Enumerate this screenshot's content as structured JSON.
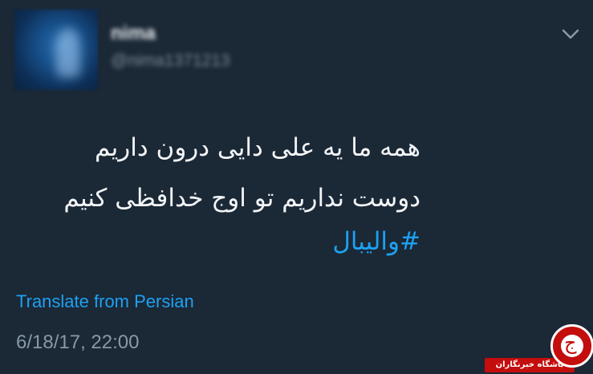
{
  "tweet": {
    "author_name": "nima",
    "author_handle": "@nima1371213",
    "lines": [
      "همه ما یه علی دایی درون داریم",
      "دوست نداریم تو اوج خدافظی کنیم"
    ],
    "hashtag": "#والیبال",
    "translate_label": "Translate from Persian",
    "timestamp": "6/18/17, 22:00"
  },
  "icons": {
    "menu": "chevron-down-icon",
    "watermark_logo": "news-club-logo"
  },
  "watermark": {
    "text": "باشگاه خبرنگاران",
    "glyph": "ج"
  },
  "colors": {
    "background": "#1b2836",
    "text": "#f3f5f7",
    "link": "#1da1f2",
    "muted": "#8899a6",
    "watermark_red": "#c40d0d"
  }
}
